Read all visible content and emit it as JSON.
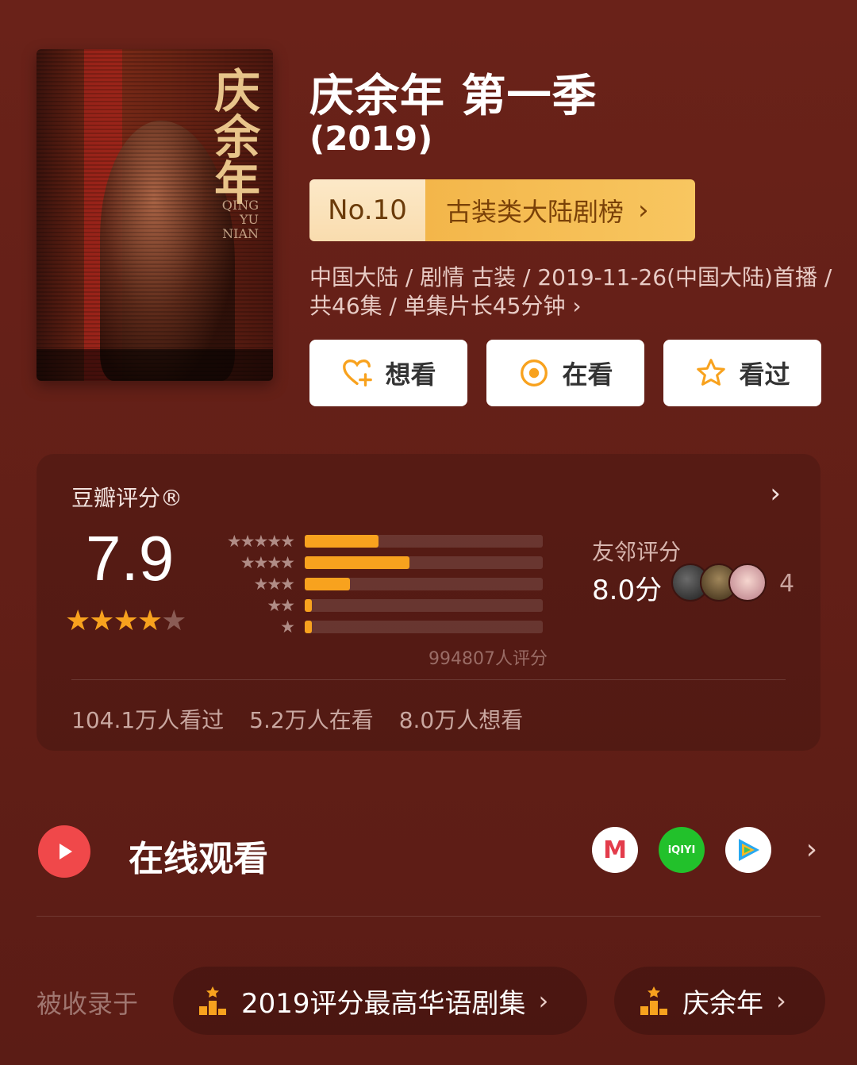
{
  "show": {
    "title": "庆余年 第一季",
    "year": "(2019)"
  },
  "poster": {
    "calligraphy": "庆余年",
    "latin_line1": "QING",
    "latin_line2": "YU",
    "latin_line3": "NIAN"
  },
  "ranking": {
    "number": "No.10",
    "board": "古装类大陆剧榜",
    "chevron": "›"
  },
  "meta": {
    "text": "中国大陆 / 剧情 古装 / 2019-11-26(中国大陆)首播 / 共46集 / 单集片长45分钟 ›"
  },
  "actions": {
    "want_label": "想看",
    "watching_label": "在看",
    "watched_label": "看过"
  },
  "rating": {
    "label": "豆瓣评分®",
    "score": "7.9",
    "stars_shown": 4,
    "total_stars": 5,
    "distribution": [
      {
        "stars": "★★★★★",
        "percent": 31
      },
      {
        "stars": "★★★★",
        "percent": 44
      },
      {
        "stars": "★★★",
        "percent": 19
      },
      {
        "stars": "★★",
        "percent": 3
      },
      {
        "stars": "★",
        "percent": 3
      }
    ],
    "count": "994807人评分",
    "friends_label": "友邻评分",
    "friends_score": "8.0分",
    "friends_count": "4",
    "stats": [
      "104.1万人看过",
      "5.2万人在看",
      "8.0万人想看"
    ],
    "chevron": "›"
  },
  "watch_online": {
    "title": "在线观看",
    "platforms": [
      {
        "name": "mgtv-icon",
        "glyph": "M"
      },
      {
        "name": "iqiyi-icon",
        "glyph": "iQIYI"
      },
      {
        "name": "tencent-video-icon",
        "glyph": ""
      }
    ],
    "chevron": "›"
  },
  "collections": {
    "label": "被收录于",
    "items": [
      {
        "label": "2019评分最高华语剧集",
        "chevron": "›"
      },
      {
        "label": "庆余年",
        "chevron": "›"
      }
    ]
  },
  "colors": {
    "background": "#5e1d15",
    "star": "#f8a21e",
    "rank_badge": "#f8c660",
    "play": "#f0484a"
  }
}
